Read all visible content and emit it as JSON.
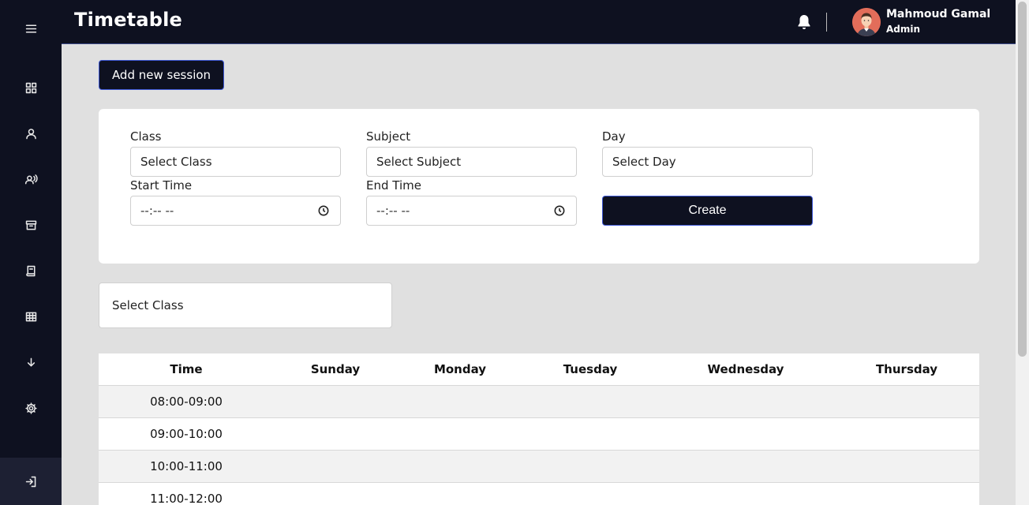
{
  "header": {
    "title": "Timetable",
    "user": {
      "name": "Mahmoud Gamal",
      "role": "Admin"
    }
  },
  "sidebar": {
    "items": [
      {
        "icon": "menu-icon"
      },
      {
        "icon": "dashboard-icon"
      },
      {
        "icon": "user-icon"
      },
      {
        "icon": "teachers-icon"
      },
      {
        "icon": "archive-icon"
      },
      {
        "icon": "book-icon"
      },
      {
        "icon": "table-icon"
      },
      {
        "icon": "download-icon"
      },
      {
        "icon": "settings-icon"
      },
      {
        "icon": "logout-icon"
      }
    ]
  },
  "toolbar": {
    "add_label": "Add new session"
  },
  "form": {
    "class_label": "Class",
    "class_value": "Select Class",
    "subject_label": "Subject",
    "subject_value": "Select Subject",
    "day_label": "Day",
    "day_value": "Select Day",
    "start_label": "Start Time",
    "start_value": "--:-- --",
    "end_label": "End Time",
    "end_value": "--:-- --",
    "create_label": "Create"
  },
  "filter": {
    "class_value": "Select Class"
  },
  "timetable": {
    "headers": [
      "Time",
      "Sunday",
      "Monday",
      "Tuesday",
      "Wednesday",
      "Thursday"
    ],
    "rows": [
      "08:00-09:00",
      "09:00-10:00",
      "10:00-11:00",
      "11:00-12:00"
    ]
  },
  "colors": {
    "dark": "#0e1120",
    "accent": "#3f59d6",
    "background": "#e0e0e0"
  }
}
